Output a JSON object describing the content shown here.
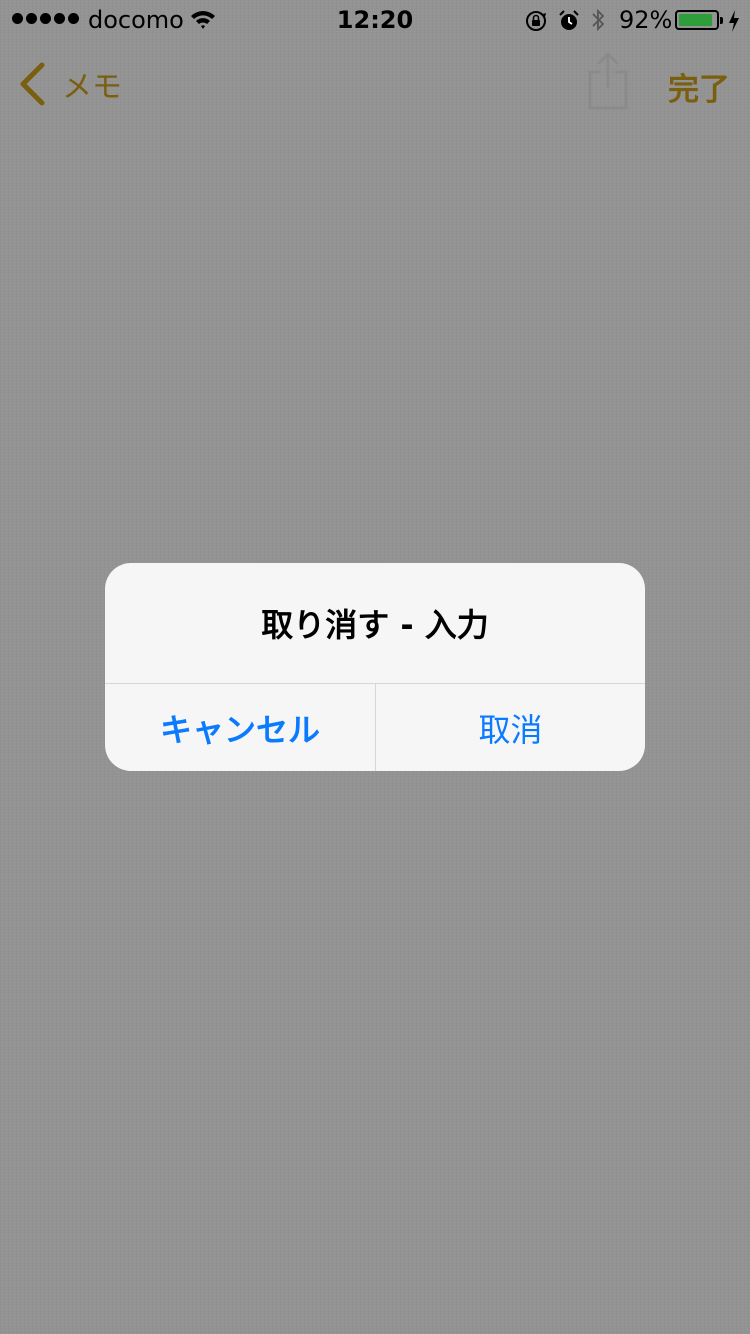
{
  "status_bar": {
    "carrier": "docomo",
    "time": "12:20",
    "battery_percent": "92%",
    "battery_level": 0.92,
    "battery_color": "#2f9e3a"
  },
  "nav": {
    "back_label": "メモ",
    "back_icon": "chevron-left-icon",
    "share_icon": "share-icon",
    "done_label": "完了",
    "accent_color": "#7a5f0e"
  },
  "alert": {
    "title": "取り消す - 入力",
    "cancel_label": "キャンセル",
    "undo_label": "取消",
    "button_color": "#0a7aff"
  }
}
